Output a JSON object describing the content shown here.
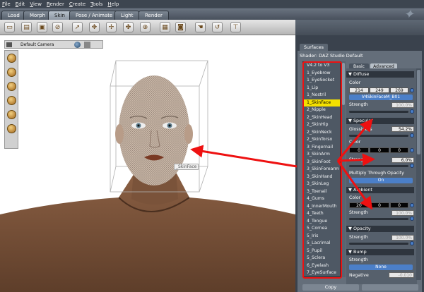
{
  "menu": [
    {
      "mnemonic": "F",
      "rest": "ile"
    },
    {
      "mnemonic": "E",
      "rest": "dit"
    },
    {
      "mnemonic": "V",
      "rest": "iew"
    },
    {
      "mnemonic": "R",
      "rest": "ender"
    },
    {
      "mnemonic": "C",
      "rest": "reate"
    },
    {
      "mnemonic": "T",
      "rest": "ools"
    },
    {
      "mnemonic": "H",
      "rest": "elp"
    }
  ],
  "tabs": [
    "Load",
    "Morph",
    "Skin",
    "Pose / Animate",
    "Light",
    "Render"
  ],
  "active_tab": "Skin",
  "viewport": {
    "camera": "Default Camera",
    "hover_label": "_SkinFace"
  },
  "panel": {
    "tab": "Surfaces",
    "shader": "Shader: DAZ Studio Default",
    "list_header": "V4.2 to V3",
    "items": [
      "1_Eyebrow",
      "1_EyeSocket",
      "1_Lip",
      "1_Nostril",
      "1_SkinFace",
      "2_Nipple",
      "2_SkinHead",
      "2_SkinHip",
      "2_SkinNeck",
      "2_SkinTorso",
      "3_Fingernail",
      "3_SkinArm",
      "3_SkinFoot",
      "3_SkinForearm",
      "3_SkinHand",
      "3_SkinLeg",
      "3_Toenail",
      "4_Gums",
      "4_InnerMouth",
      "4_Teeth",
      "4_Tongue",
      "5_Cornea",
      "5_Iris",
      "5_Lacrimal",
      "5_Pupil",
      "5_Sclera",
      "6_Eyelash",
      "7_EyeSurface"
    ],
    "selected_item": "1_SkinFace",
    "subtabs": {
      "basic": "Basic",
      "advanced": "Advanced"
    },
    "diffuse": {
      "title": "Diffuse",
      "color_label": "Color",
      "color": [
        "214",
        "249",
        "269"
      ],
      "map_name": "V4SkinFaceM_B01",
      "strength_label": "Strength",
      "strength": "100.0%"
    },
    "specular": {
      "title": "Specular",
      "glossiness_label": "Glossiness",
      "glossiness": "54.2%",
      "color_label": "Color",
      "color": [
        "0",
        "0",
        "0"
      ],
      "strength_label": "Strength",
      "strength": "6.0%",
      "multiply_label": "Multiply Through Opacity",
      "multiply_value": "On"
    },
    "ambient": {
      "title": "Ambient",
      "color_label": "Color",
      "color": [
        "20",
        "0",
        "0"
      ],
      "strength_label": "Strength",
      "strength": "100.0%"
    },
    "opacity": {
      "title": "Opacity",
      "strength_label": "Strength",
      "strength": "100.0%"
    },
    "bump": {
      "title": "Bump",
      "strength_label": "Strength",
      "strength_value": "None",
      "negative_label": "Negative",
      "negative": "-0.010"
    },
    "copy_label": "Copy"
  },
  "colors": {
    "highlight": "#ee1111",
    "selection": "#f4e000",
    "accent": "#4b7fc8"
  },
  "icons": [
    "new-icon",
    "open-icon",
    "save-icon",
    "stop-icon",
    "select-icon",
    "rotate-icon",
    "move-icon",
    "scale-icon",
    "node-icon",
    "camera-icon",
    "render-icon",
    "hand-icon",
    "spin-icon",
    "pin-icon"
  ]
}
